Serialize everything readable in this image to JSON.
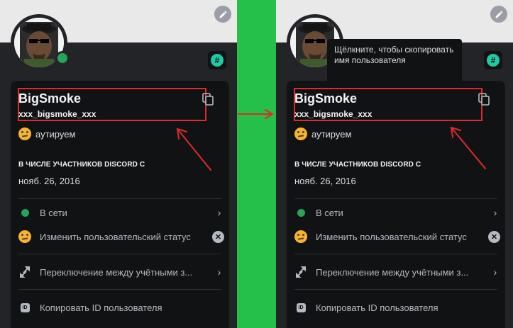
{
  "panels": [
    {
      "display_name": "BigSmoke",
      "username": "xxx_bigsmoke_xxx",
      "custom_status": "аутируем",
      "member_since_heading": "В ЧИСЛЕ УЧАСТНИКОВ DISCORD С",
      "member_since_date": "нояб. 26, 2016",
      "menu": {
        "online": "В сети",
        "edit_status": "Изменить пользовательский статус",
        "switch_accounts": "Переключение между учётными з...",
        "copy_id": "Копировать ID пользователя"
      },
      "badge_symbol": "#",
      "id_badge": "ID"
    },
    {
      "display_name": "BigSmoke",
      "username": "xxx_bigsmoke_xxx",
      "custom_status": "аутируем",
      "member_since_heading": "В ЧИСЛЕ УЧАСТНИКОВ DISCORD С",
      "member_since_date": "нояб. 26, 2016",
      "menu": {
        "online": "В сети",
        "edit_status": "Изменить пользовательский статус",
        "switch_accounts": "Переключение между учётными з...",
        "copy_id": "Копировать ID пользователя"
      },
      "badge_symbol": "#",
      "id_badge": "ID"
    }
  ],
  "tooltip": "Щёлкните, чтобы скопировать имя пользователя",
  "colors": {
    "background_green": "#24c04a",
    "panel": "#232428",
    "card": "#111214",
    "annotation_red": "#e02a2a",
    "online_green": "#23a55a"
  },
  "icons": [
    "pencil-icon",
    "hashtag-badge-icon",
    "copy-icon",
    "online-dot-icon",
    "emoji-thinking-icon",
    "clear-x-icon",
    "switch-account-icon",
    "chevron-right-icon",
    "id-badge-icon",
    "red-arrow-annotation"
  ]
}
